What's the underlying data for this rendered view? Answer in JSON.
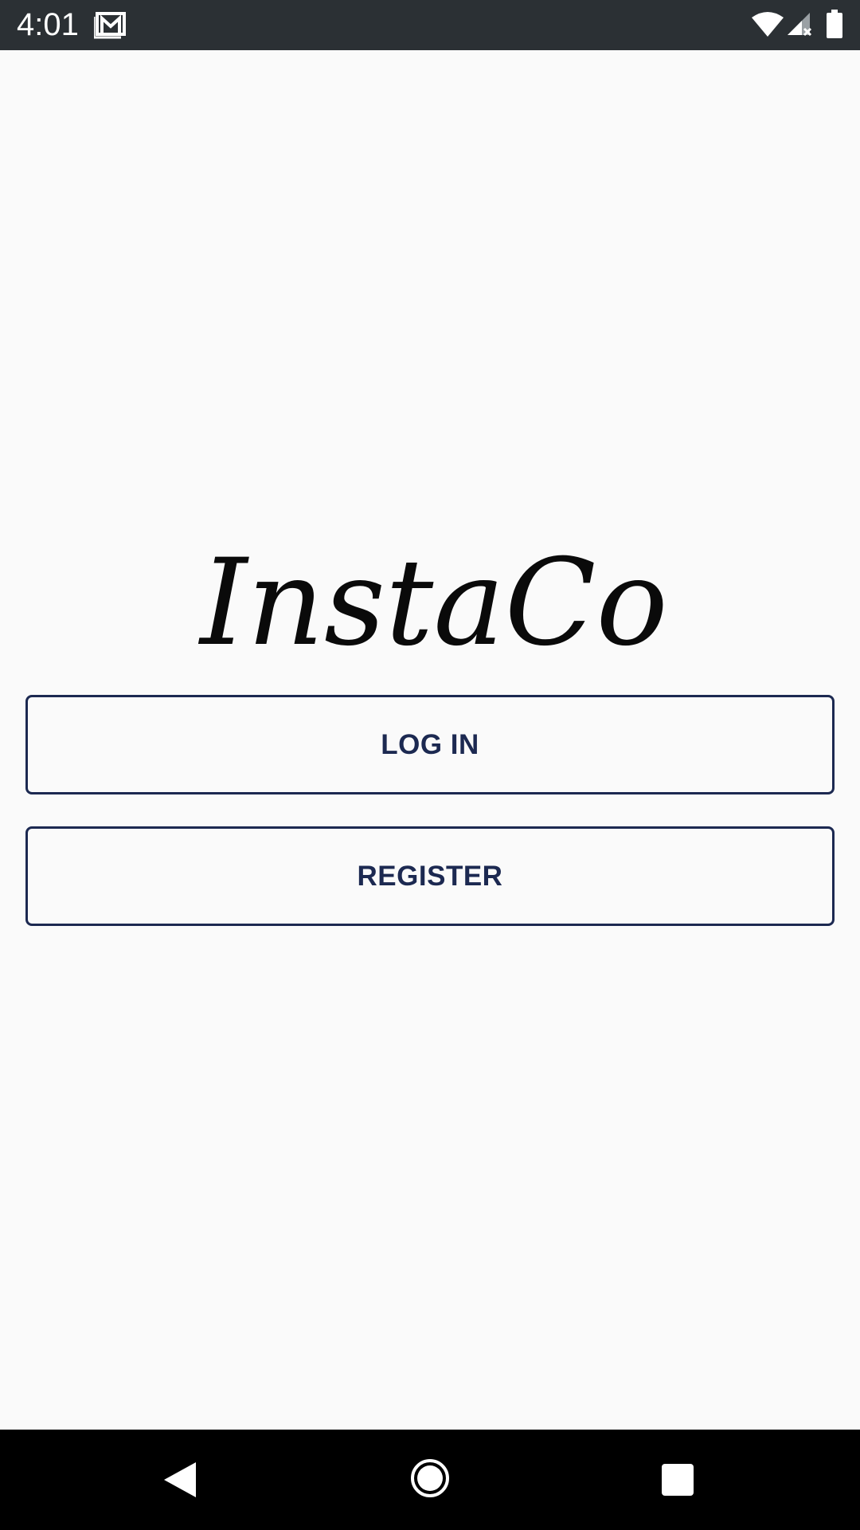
{
  "status_bar": {
    "time": "4:01",
    "icons": [
      "mail-icon",
      "wifi-icon",
      "signal-icon",
      "battery-icon"
    ]
  },
  "logo": {
    "text": "InstaCo"
  },
  "buttons": {
    "login_label": "LOG IN",
    "register_label": "REGISTER"
  },
  "navigation": {
    "icons": [
      "back-icon",
      "home-icon",
      "recents-icon"
    ]
  },
  "colors": {
    "status_bar": "#2b3034",
    "background": "#fafafa",
    "accent": "#1c2951",
    "nav_bar": "#000000"
  }
}
